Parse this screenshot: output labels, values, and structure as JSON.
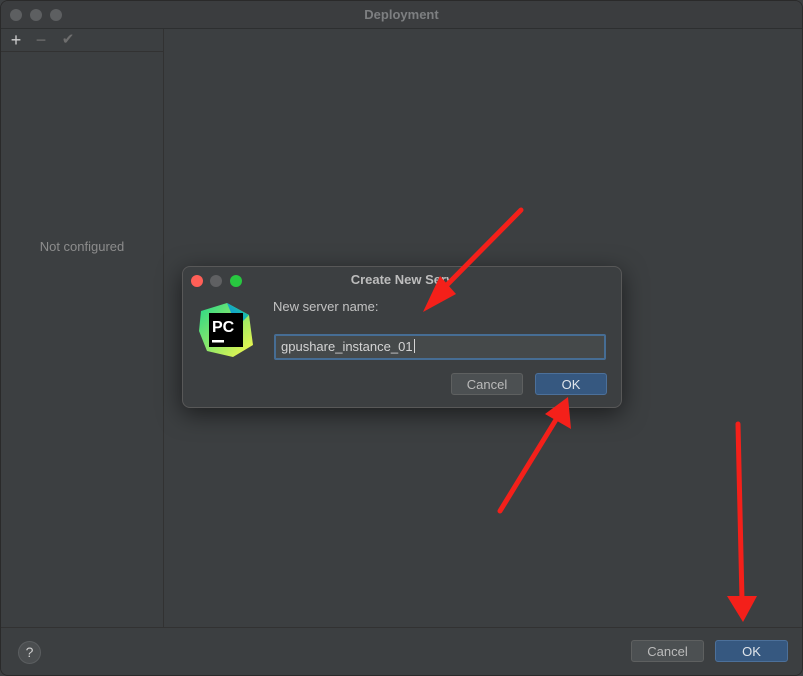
{
  "window": {
    "title": "Deployment"
  },
  "sidebar": {
    "toolbar": {
      "add_glyph": "+",
      "remove_glyph": "−",
      "apply_glyph": "✔"
    },
    "empty_text": "Not configured"
  },
  "footer": {
    "help_label": "?",
    "cancel_label": "Cancel",
    "ok_label": "OK"
  },
  "dialog": {
    "title": "Create New Serv",
    "logo_text": "PC",
    "field_label": "New server name:",
    "field_value": "gpushare_instance_01",
    "cancel_label": "Cancel",
    "ok_label": "OK"
  },
  "colors": {
    "background": "#3c3f41",
    "primary_button": "#365880",
    "annotation_arrow": "#f4201a",
    "traffic_close": "#ff5f57",
    "traffic_minimize": "#5f6062",
    "traffic_zoom": "#28c840"
  },
  "icons": {
    "help": "question-circle-icon",
    "logo": "pycharm-logo-icon",
    "annotation": "red-arrow-icon"
  }
}
